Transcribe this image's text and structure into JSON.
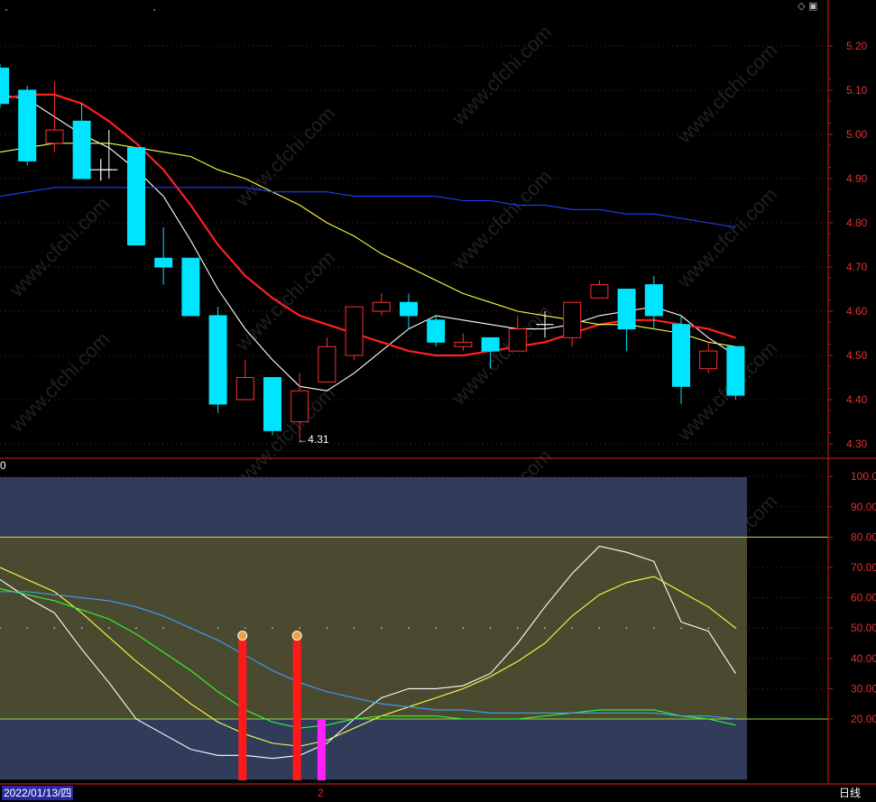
{
  "chart_data": [
    {
      "type": "candlestick",
      "ylim": [
        4.27,
        5.23
      ],
      "y_ticks": [
        4.3,
        4.4,
        4.5,
        4.6,
        4.7,
        4.8,
        4.9,
        5.0,
        5.1,
        5.2
      ],
      "y_tick_labels": [
        "4.30",
        "4.40",
        "4.50",
        "4.60",
        "4.70",
        "4.80",
        "4.90",
        "5.00",
        "5.10",
        "5.20"
      ],
      "grid": true,
      "low_annotation": "←4.31",
      "low_value": 4.31,
      "candles": [
        {
          "o": 5.15,
          "c": 5.07,
          "h": 5.16,
          "l": 5.06
        },
        {
          "o": 5.1,
          "c": 4.94,
          "h": 5.11,
          "l": 4.93
        },
        {
          "o": 4.98,
          "c": 5.01,
          "h": 5.12,
          "l": 4.96
        },
        {
          "o": 5.03,
          "c": 4.9,
          "h": 5.07,
          "l": 4.9
        },
        {
          "o": 4.92,
          "c": 4.92,
          "h": 5.01,
          "l": 4.9
        },
        {
          "o": 4.97,
          "c": 4.75,
          "h": 4.97,
          "l": 4.75
        },
        {
          "o": 4.72,
          "c": 4.7,
          "h": 4.79,
          "l": 4.66
        },
        {
          "o": 4.72,
          "c": 4.59,
          "h": 4.72,
          "l": 4.59
        },
        {
          "o": 4.59,
          "c": 4.39,
          "h": 4.61,
          "l": 4.37
        },
        {
          "o": 4.4,
          "c": 4.45,
          "h": 4.49,
          "l": 4.4
        },
        {
          "o": 4.45,
          "c": 4.33,
          "h": 4.45,
          "l": 4.32
        },
        {
          "o": 4.35,
          "c": 4.42,
          "h": 4.46,
          "l": 4.31
        },
        {
          "o": 4.44,
          "c": 4.52,
          "h": 4.54,
          "l": 4.44
        },
        {
          "o": 4.5,
          "c": 4.61,
          "h": 4.61,
          "l": 4.49
        },
        {
          "o": 4.6,
          "c": 4.62,
          "h": 4.64,
          "l": 4.59
        },
        {
          "o": 4.62,
          "c": 4.59,
          "h": 4.64,
          "l": 4.56
        },
        {
          "o": 4.58,
          "c": 4.53,
          "h": 4.59,
          "l": 4.52
        },
        {
          "o": 4.52,
          "c": 4.53,
          "h": 4.55,
          "l": 4.51
        },
        {
          "o": 4.54,
          "c": 4.51,
          "h": 4.54,
          "l": 4.47
        },
        {
          "o": 4.51,
          "c": 4.56,
          "h": 4.59,
          "l": 4.51
        },
        {
          "o": 4.57,
          "c": 4.57,
          "h": 4.6,
          "l": 4.54
        },
        {
          "o": 4.54,
          "c": 4.62,
          "h": 4.62,
          "l": 4.52
        },
        {
          "o": 4.63,
          "c": 4.66,
          "h": 4.67,
          "l": 4.63
        },
        {
          "o": 4.65,
          "c": 4.56,
          "h": 4.65,
          "l": 4.51
        },
        {
          "o": 4.66,
          "c": 4.59,
          "h": 4.68,
          "l": 4.56
        },
        {
          "o": 4.57,
          "c": 4.43,
          "h": 4.59,
          "l": 4.39
        },
        {
          "o": 4.47,
          "c": 4.51,
          "h": 4.53,
          "l": 4.46
        },
        {
          "o": 4.52,
          "c": 4.41,
          "h": 4.52,
          "l": 4.4
        }
      ],
      "series": [
        {
          "color": "#ffffff",
          "values": [
            5.09,
            5.08,
            5.04,
            5.0,
            4.97,
            4.92,
            4.86,
            4.76,
            4.65,
            4.56,
            4.49,
            4.43,
            4.42,
            4.46,
            4.51,
            4.56,
            4.59,
            4.58,
            4.57,
            4.56,
            4.56,
            4.57,
            4.59,
            4.6,
            4.61,
            4.59,
            4.54,
            4.5
          ]
        },
        {
          "color": "#ff2020",
          "values": [
            5.08,
            5.09,
            5.09,
            5.07,
            5.03,
            4.98,
            4.92,
            4.84,
            4.75,
            4.68,
            4.63,
            4.59,
            4.57,
            4.55,
            4.53,
            4.51,
            4.5,
            4.5,
            4.51,
            4.52,
            4.53,
            4.55,
            4.57,
            4.58,
            4.58,
            4.57,
            4.56,
            4.54
          ]
        },
        {
          "color": "#ffff40",
          "values": [
            4.96,
            4.97,
            4.98,
            4.98,
            4.98,
            4.97,
            4.96,
            4.95,
            4.92,
            4.9,
            4.87,
            4.84,
            4.8,
            4.77,
            4.73,
            4.7,
            4.67,
            4.64,
            4.62,
            4.6,
            4.59,
            4.58,
            4.57,
            4.57,
            4.56,
            4.55,
            4.53,
            4.52
          ]
        },
        {
          "color": "#2040ff",
          "values": [
            4.86,
            4.87,
            4.88,
            4.88,
            4.88,
            4.88,
            4.88,
            4.88,
            4.88,
            4.88,
            4.87,
            4.87,
            4.87,
            4.86,
            4.86,
            4.86,
            4.86,
            4.85,
            4.85,
            4.84,
            4.84,
            4.83,
            4.83,
            4.82,
            4.82,
            4.81,
            4.8,
            4.79
          ]
        }
      ]
    },
    {
      "type": "line",
      "ylim": [
        0,
        110
      ],
      "y_ticks": [
        20,
        30,
        40,
        50,
        60,
        70,
        80,
        90,
        100
      ],
      "y_tick_labels": [
        "20.00",
        "30.00",
        "40.00",
        "50.00",
        "60.00",
        "70.00",
        "80.00",
        "90.00",
        "100.0"
      ],
      "partial_label": "0",
      "bands": [
        {
          "from": 80,
          "to": 100,
          "color": "#313c5a"
        },
        {
          "from": 20,
          "to": 80,
          "color": "#4a4a30"
        },
        {
          "from": 0,
          "to": 20,
          "color": "#313c5a"
        }
      ],
      "band_lines": [
        {
          "value": 80,
          "color": "#d8d840"
        },
        {
          "value": 20,
          "color": "#90d840"
        }
      ],
      "series": [
        {
          "color": "#ffffff",
          "values": [
            66,
            60,
            55,
            43,
            32,
            20,
            15,
            10,
            8,
            8,
            7,
            8,
            12,
            20,
            27,
            30,
            30,
            31,
            35,
            45,
            57,
            68,
            77,
            75,
            72,
            52,
            49,
            35
          ]
        },
        {
          "color": "#ffff40",
          "values": [
            70,
            66,
            62,
            55,
            47,
            39,
            32,
            25,
            19,
            15,
            12,
            11,
            13,
            17,
            21,
            24,
            27,
            30,
            34,
            39,
            45,
            54,
            61,
            65,
            67,
            62,
            57,
            50
          ]
        },
        {
          "color": "#30ff30",
          "values": [
            63,
            61,
            59,
            56,
            53,
            48,
            42,
            36,
            29,
            23,
            19,
            17,
            18,
            20,
            21,
            21,
            21,
            20,
            20,
            20,
            21,
            22,
            23,
            23,
            23,
            21,
            20,
            18
          ]
        },
        {
          "color": "#40a0ff",
          "values": [
            62,
            62,
            61,
            60,
            59,
            57,
            54,
            50,
            46,
            41,
            36,
            32,
            29,
            27,
            25,
            24,
            23,
            23,
            22,
            22,
            22,
            22,
            22,
            22,
            22,
            21,
            21,
            20
          ]
        }
      ],
      "signal_bars": [
        {
          "index": 8.9,
          "value": 46,
          "color": "#ff1a1a"
        },
        {
          "index": 10.9,
          "value": 46,
          "color": "#ff1a1a"
        },
        {
          "index": 11.8,
          "value": 20,
          "color": "#ff20ff"
        }
      ],
      "markers": [
        {
          "index": 8.9,
          "value": 47.5
        },
        {
          "index": 10.9,
          "value": 47.5
        }
      ]
    }
  ],
  "status": {
    "date": "2022/01/13/四",
    "mark": "2",
    "period": "日线"
  },
  "watermark": "www.cfchi.com"
}
